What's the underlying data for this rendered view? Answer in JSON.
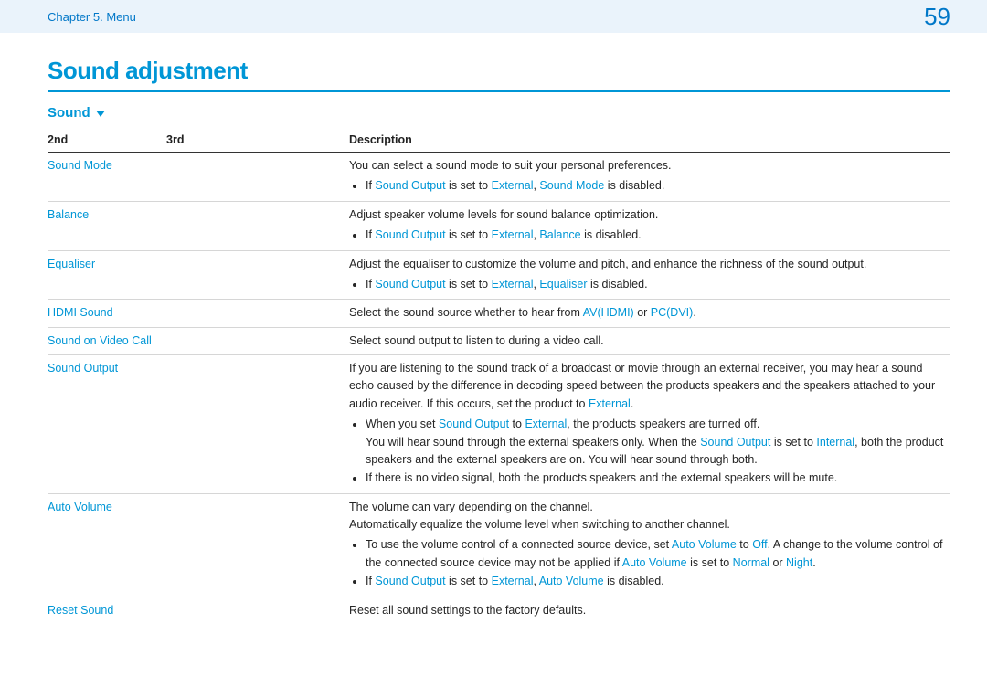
{
  "header": {
    "breadcrumb": "Chapter 5. Menu",
    "page": "59"
  },
  "title": "Sound adjustment",
  "sound_label": "Sound",
  "table": {
    "headers": {
      "c1": "2nd",
      "c2": "3rd",
      "c3": "Description"
    },
    "rows": {
      "sound_mode": {
        "label": "Sound Mode",
        "line1": "You can select a sound mode to suit your personal preferences.",
        "note_prefix": "If ",
        "t_sound_output": "Sound Output",
        "mid": " is set to ",
        "t_external": "External",
        "sep": ", ",
        "t_sound_mode": "Sound Mode",
        "suffix": " is disabled."
      },
      "balance": {
        "label": "Balance",
        "line1": "Adjust speaker volume levels for sound balance optimization.",
        "note_prefix": "If ",
        "t_sound_output": "Sound Output",
        "mid": " is set to ",
        "t_external": "External",
        "sep": ", ",
        "t_balance": "Balance",
        "suffix": " is disabled."
      },
      "equaliser": {
        "label": "Equaliser",
        "line1": "Adjust the equaliser to customize the volume and pitch, and enhance the richness of the sound output.",
        "note_prefix": "If ",
        "t_sound_output": "Sound Output",
        "mid": " is set to ",
        "t_external": "External",
        "sep": ", ",
        "t_equaliser": "Equaliser",
        "suffix": " is disabled."
      },
      "hdmi_sound": {
        "label": "HDMI Sound",
        "line_pre": "Select the sound source whether to hear from ",
        "t_av": "AV(HDMI)",
        "or": " or ",
        "t_pc": "PC(DVI)",
        "period": "."
      },
      "sovc": {
        "label": "Sound on Video Call",
        "line1": "Select sound output to listen to during a video call."
      },
      "sound_output": {
        "label": "Sound Output",
        "para_pre": "If you are listening to the sound track of a broadcast or movie through an external receiver, you may hear a sound echo caused by the difference in decoding speed between the products speakers and the speakers attached to your audio receiver. If this occurs, set the product to ",
        "t_external": "External",
        "para_post": ".",
        "b1_pre": "When you set ",
        "b1_t1": "Sound Output",
        "b1_mid": " to ",
        "b1_t2": "External",
        "b1_post": ", the products speakers are turned off.",
        "b1_cont": "You will hear sound through the external speakers only. When the ",
        "b1_t3": "Sound Output",
        "b1_mid2": " is set to ",
        "b1_t4": "Internal",
        "b1_cont2": ", both the product speakers and the external speakers are on. You will hear sound through both.",
        "b2": "If there is no video signal, both the products speakers and the external speakers will be mute."
      },
      "auto_volume": {
        "label": "Auto Volume",
        "line1": "The volume can vary depending on the channel.",
        "line2": "Automatically equalize the volume level when switching to another channel.",
        "b1_pre": "To use the volume control of a connected source device, set ",
        "b1_t1": "Auto Volume",
        "b1_mid": " to ",
        "b1_t2": "Off",
        "b1_post": ". A change to the volume control of the connected source device may not be applied if ",
        "b1_t3": "Auto Volume",
        "b1_mid2": " is set to ",
        "b1_t4": "Normal",
        "b1_or": " or ",
        "b1_t5": "Night",
        "b1_end": ".",
        "b2_pre": "If ",
        "b2_t1": "Sound Output",
        "b2_mid": " is set to ",
        "b2_t2": "External",
        "b2_sep": ", ",
        "b2_t3": "Auto Volume",
        "b2_suffix": " is disabled."
      },
      "reset_sound": {
        "label": "Reset Sound",
        "line1": "Reset all sound settings to the factory defaults."
      }
    }
  }
}
